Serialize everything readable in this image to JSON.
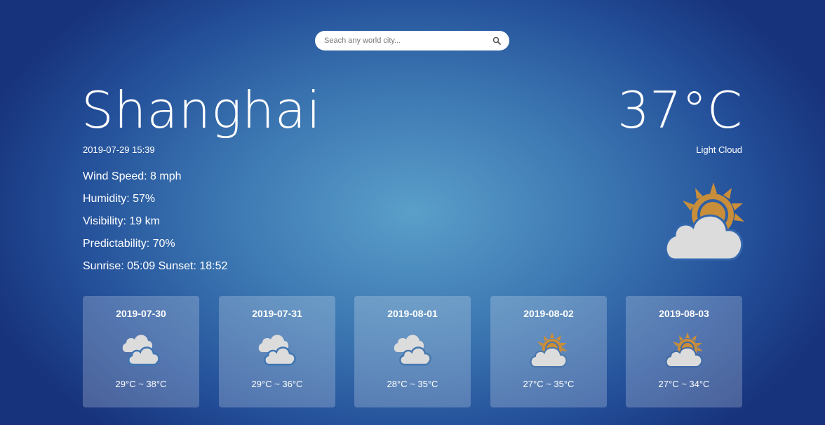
{
  "search": {
    "placeholder": "Seach any world city..."
  },
  "icons": {
    "search": "search-icon",
    "cloud": "cloud-icon",
    "sun": "sun-icon"
  },
  "colors": {
    "sun": "#c98e3a",
    "cloud": "#dcdcdc"
  },
  "current": {
    "city": "Shanghai",
    "datetime": "2019-07-29 15:39",
    "temperature": "37°C",
    "condition": "Light Cloud",
    "condition_icon": "light-cloud-icon",
    "details": [
      "Wind Speed: 8 mph",
      "Humidity: 57%",
      "Visibility: 19 km",
      "Predictability: 70%",
      "Sunrise: 05:09 Sunset: 18:52"
    ]
  },
  "forecast": [
    {
      "date": "2019-07-30",
      "range": "29°C ~ 38°C",
      "icon": "heavy-cloud-icon"
    },
    {
      "date": "2019-07-31",
      "range": "29°C ~ 36°C",
      "icon": "heavy-cloud-icon"
    },
    {
      "date": "2019-08-01",
      "range": "28°C ~ 35°C",
      "icon": "heavy-cloud-icon"
    },
    {
      "date": "2019-08-02",
      "range": "27°C ~ 35°C",
      "icon": "light-cloud-icon"
    },
    {
      "date": "2019-08-03",
      "range": "27°C ~ 34°C",
      "icon": "light-cloud-icon"
    }
  ]
}
